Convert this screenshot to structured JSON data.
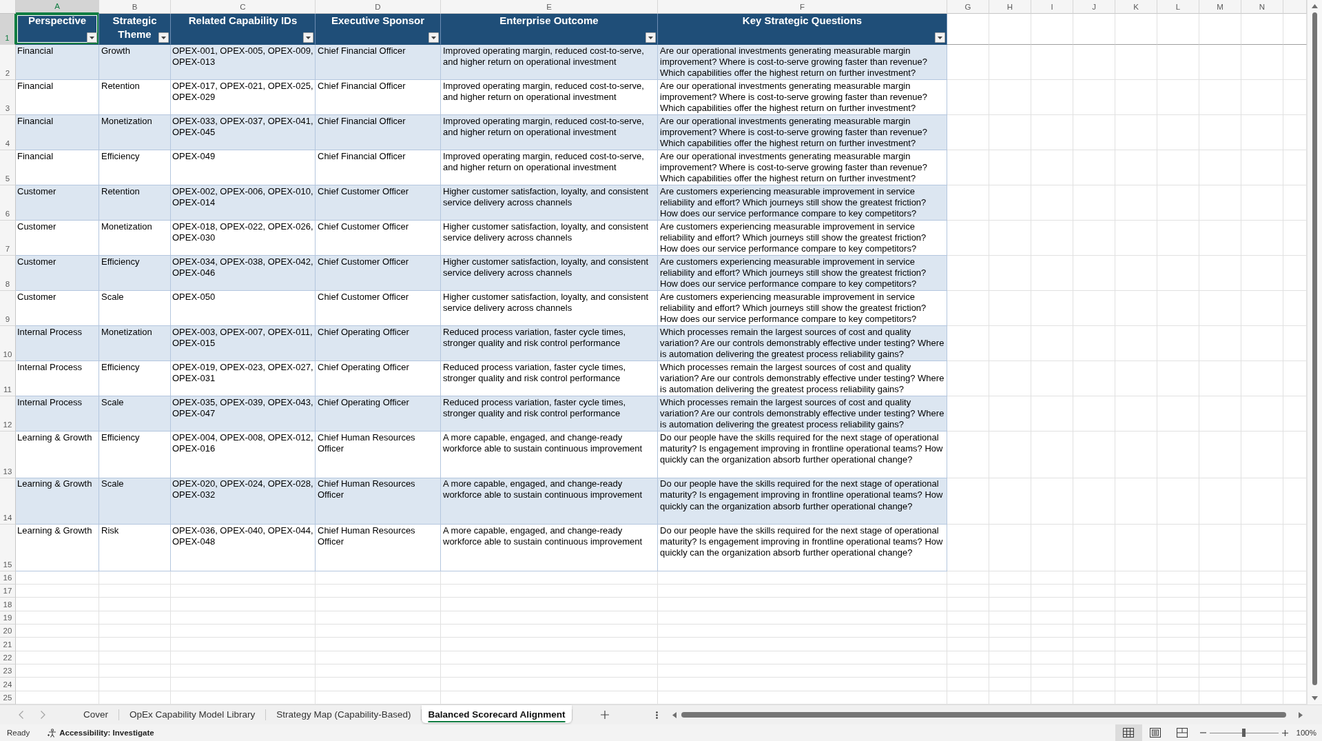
{
  "column_headers": [
    {
      "label": "A",
      "selected": true
    },
    {
      "label": "B",
      "selected": false
    },
    {
      "label": "C",
      "selected": false
    },
    {
      "label": "D",
      "selected": false
    },
    {
      "label": "E",
      "selected": false
    },
    {
      "label": "F",
      "selected": false
    },
    {
      "label": "G",
      "selected": false
    },
    {
      "label": "H",
      "selected": false
    },
    {
      "label": "I",
      "selected": false
    },
    {
      "label": "J",
      "selected": false
    },
    {
      "label": "K",
      "selected": false
    },
    {
      "label": "L",
      "selected": false
    },
    {
      "label": "M",
      "selected": false
    },
    {
      "label": "N",
      "selected": false
    }
  ],
  "row_numbers": [
    {
      "label": "1",
      "selected": true
    },
    {
      "label": "2",
      "selected": false
    },
    {
      "label": "3",
      "selected": false
    },
    {
      "label": "4",
      "selected": false
    },
    {
      "label": "5",
      "selected": false
    },
    {
      "label": "6",
      "selected": false
    },
    {
      "label": "7",
      "selected": false
    },
    {
      "label": "8",
      "selected": false
    },
    {
      "label": "9",
      "selected": false
    },
    {
      "label": "10",
      "selected": false
    },
    {
      "label": "11",
      "selected": false
    },
    {
      "label": "12",
      "selected": false
    },
    {
      "label": "13",
      "selected": false
    },
    {
      "label": "14",
      "selected": false
    },
    {
      "label": "15",
      "selected": false
    },
    {
      "label": "16",
      "selected": false
    },
    {
      "label": "17",
      "selected": false
    },
    {
      "label": "18",
      "selected": false
    },
    {
      "label": "19",
      "selected": false
    },
    {
      "label": "20",
      "selected": false
    },
    {
      "label": "21",
      "selected": false
    },
    {
      "label": "22",
      "selected": false
    },
    {
      "label": "23",
      "selected": false
    },
    {
      "label": "24",
      "selected": false
    },
    {
      "label": "25",
      "selected": false
    }
  ],
  "table": {
    "columns": [
      {
        "label": "Perspective",
        "filter": true
      },
      {
        "label": "Strategic Theme",
        "filter": true
      },
      {
        "label": "Related Capability IDs",
        "filter": true
      },
      {
        "label": "Executive Sponsor",
        "filter": true
      },
      {
        "label": "Enterprise Outcome",
        "filter": true
      },
      {
        "label": "Key Strategic Questions",
        "filter": true
      }
    ],
    "rows": [
      {
        "cells": [
          "Financial",
          "Growth",
          "OPEX-001, OPEX-005, OPEX-009, OPEX-013",
          "Chief Financial Officer",
          "Improved operating margin, reduced cost-to-serve, and higher return on operational investment",
          "Are our operational investments generating measurable margin improvement? Where is cost-to-serve growing faster than revenue? Which capabilities offer the highest return on further investment?"
        ]
      },
      {
        "cells": [
          "Financial",
          "Retention",
          "OPEX-017, OPEX-021, OPEX-025, OPEX-029",
          "Chief Financial Officer",
          "Improved operating margin, reduced cost-to-serve, and higher return on operational investment",
          "Are our operational investments generating measurable margin improvement? Where is cost-to-serve growing faster than revenue? Which capabilities offer the highest return on further investment?"
        ]
      },
      {
        "cells": [
          "Financial",
          "Monetization",
          "OPEX-033, OPEX-037, OPEX-041, OPEX-045",
          "Chief Financial Officer",
          "Improved operating margin, reduced cost-to-serve, and higher return on operational investment",
          "Are our operational investments generating measurable margin improvement? Where is cost-to-serve growing faster than revenue? Which capabilities offer the highest return on further investment?"
        ]
      },
      {
        "cells": [
          "Financial",
          "Efficiency",
          "OPEX-049",
          "Chief Financial Officer",
          "Improved operating margin, reduced cost-to-serve, and higher return on operational investment",
          "Are our operational investments generating measurable margin improvement? Where is cost-to-serve growing faster than revenue? Which capabilities offer the highest return on further investment?"
        ]
      },
      {
        "cells": [
          "Customer",
          "Retention",
          "OPEX-002, OPEX-006, OPEX-010, OPEX-014",
          "Chief Customer Officer",
          "Higher customer satisfaction, loyalty, and consistent service delivery across channels",
          "Are customers experiencing measurable improvement in service reliability and effort? Which journeys still show the greatest friction? How does our service performance compare to key competitors?"
        ]
      },
      {
        "cells": [
          "Customer",
          "Monetization",
          "OPEX-018, OPEX-022, OPEX-026, OPEX-030",
          "Chief Customer Officer",
          "Higher customer satisfaction, loyalty, and consistent service delivery across channels",
          "Are customers experiencing measurable improvement in service reliability and effort? Which journeys still show the greatest friction? How does our service performance compare to key competitors?"
        ]
      },
      {
        "cells": [
          "Customer",
          "Efficiency",
          "OPEX-034, OPEX-038, OPEX-042, OPEX-046",
          "Chief Customer Officer",
          "Higher customer satisfaction, loyalty, and consistent service delivery across channels",
          "Are customers experiencing measurable improvement in service reliability and effort? Which journeys still show the greatest friction? How does our service performance compare to key competitors?"
        ]
      },
      {
        "cells": [
          "Customer",
          "Scale",
          "OPEX-050",
          "Chief Customer Officer",
          "Higher customer satisfaction, loyalty, and consistent service delivery across channels",
          "Are customers experiencing measurable improvement in service reliability and effort? Which journeys still show the greatest friction? How does our service performance compare to key competitors?"
        ]
      },
      {
        "cells": [
          "Internal Process",
          "Monetization",
          "OPEX-003, OPEX-007, OPEX-011, OPEX-015",
          "Chief Operating Officer",
          "Reduced process variation, faster cycle times, stronger quality and risk control performance",
          "Which processes remain the largest sources of cost and quality variation? Are our controls demonstrably effective under testing? Where is automation delivering the greatest process reliability gains?"
        ]
      },
      {
        "cells": [
          "Internal Process",
          "Efficiency",
          "OPEX-019, OPEX-023, OPEX-027, OPEX-031",
          "Chief Operating Officer",
          "Reduced process variation, faster cycle times, stronger quality and risk control performance",
          "Which processes remain the largest sources of cost and quality variation? Are our controls demonstrably effective under testing? Where is automation delivering the greatest process reliability gains?"
        ]
      },
      {
        "cells": [
          "Internal Process",
          "Scale",
          "OPEX-035, OPEX-039, OPEX-043, OPEX-047",
          "Chief Operating Officer",
          "Reduced process variation, faster cycle times, stronger quality and risk control performance",
          "Which processes remain the largest sources of cost and quality variation? Are our controls demonstrably effective under testing? Where is automation delivering the greatest process reliability gains?"
        ]
      },
      {
        "cells": [
          "Learning & Growth",
          "Efficiency",
          "OPEX-004, OPEX-008, OPEX-012, OPEX-016",
          "Chief Human Resources Officer",
          "A more capable, engaged, and change-ready workforce able to sustain continuous improvement",
          "Do our people have the skills required for the next stage of operational maturity? Is engagement improving in frontline operational teams? How quickly can the organization absorb further operational change?"
        ]
      },
      {
        "cells": [
          "Learning & Growth",
          "Scale",
          "OPEX-020, OPEX-024, OPEX-028, OPEX-032",
          "Chief Human Resources Officer",
          "A more capable, engaged, and change-ready workforce able to sustain continuous improvement",
          "Do our people have the skills required for the next stage of operational maturity? Is engagement improving in frontline operational teams? How quickly can the organization absorb further operational change?"
        ]
      },
      {
        "cells": [
          "Learning & Growth",
          "Risk",
          "OPEX-036, OPEX-040, OPEX-044, OPEX-048",
          "Chief Human Resources Officer",
          "A more capable, engaged, and change-ready workforce able to sustain continuous improvement",
          "Do our people have the skills required for the next stage of operational maturity? Is engagement improving in frontline operational teams? How quickly can the organization absorb further operational change?"
        ]
      }
    ]
  },
  "sheet_tabs": [
    {
      "label": "Cover",
      "selected": false
    },
    {
      "label": "OpEx Capability Model Library",
      "selected": false
    },
    {
      "label": "Strategy Map (Capability-Based)",
      "selected": false
    },
    {
      "label": "Balanced Scorecard Alignment",
      "selected": true
    }
  ],
  "status_bar": {
    "status": "Ready",
    "accessibility": "Accessibility: Investigate",
    "views": [
      {
        "kind": "normal",
        "selected": true
      },
      {
        "kind": "page_layout",
        "selected": false
      },
      {
        "kind": "page_break",
        "selected": false
      }
    ],
    "zoom": {
      "level": 0.5,
      "reading": "100%"
    }
  }
}
